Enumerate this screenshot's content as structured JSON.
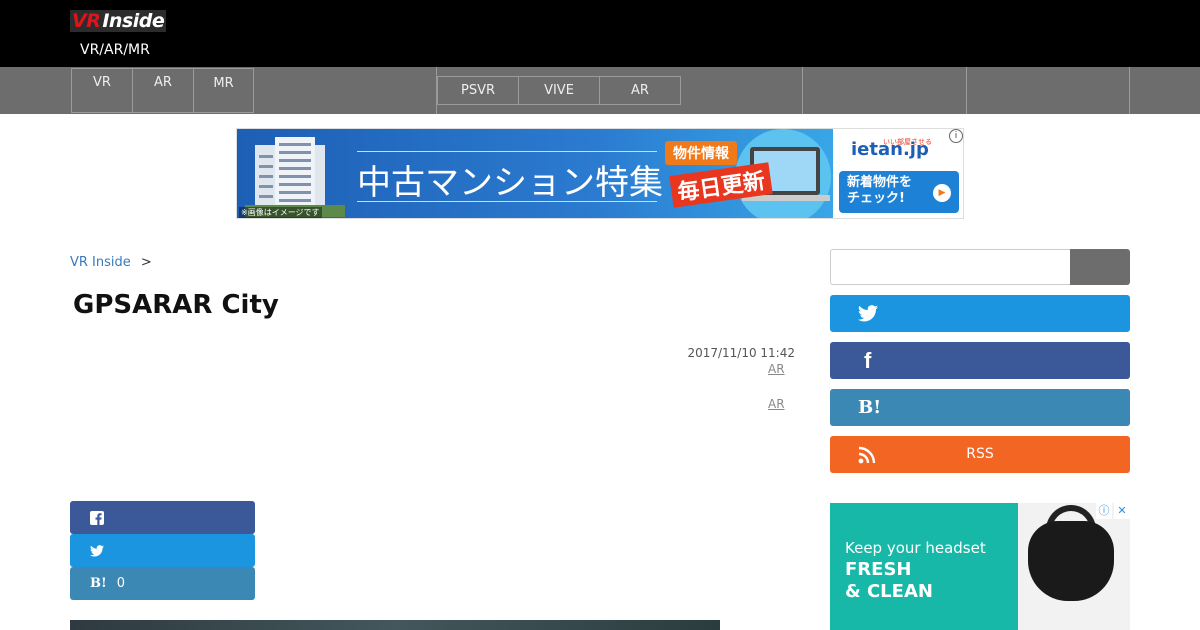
{
  "header": {
    "logo_vr": "VR",
    "logo_inside": "Inside",
    "tagline": "VR/AR/MR"
  },
  "nav": {
    "items": [
      "VR",
      "AR",
      "MR"
    ],
    "sub_tabs": [
      "PSVR",
      "VIVE",
      "AR"
    ]
  },
  "banner_ad": {
    "title": "中古マンション特集",
    "badge": "物件情報",
    "highlight": "毎日更新",
    "image_note": "※画像はイメージです",
    "brand_sub": "いい部屋させる",
    "brand": "ietan.jp",
    "cta_line1": "新着物件を",
    "cta_line2": "チェック!",
    "info": "i"
  },
  "breadcrumb": {
    "home": "VR Inside",
    "separator": ">"
  },
  "article": {
    "title": "GPSARAR City",
    "date": "2017/11/10 11:42",
    "tags": [
      "AR",
      "AR"
    ],
    "share": {
      "facebook_icon": "f",
      "twitter_icon": "twitter-bird",
      "hatena_icon": "B!",
      "hatena_count": "0"
    }
  },
  "sidebar": {
    "twitter_icon": "twitter-bird",
    "facebook_icon": "f",
    "hatena_icon": "B!",
    "rss_label": "RSS"
  },
  "side_ad": {
    "line1": "Keep your headset",
    "line2": "FRESH",
    "line3": "& CLEAN"
  },
  "colors": {
    "twitter": "#1b95e0",
    "facebook": "#3b5998",
    "hatena": "#3c88b5",
    "rss": "#f26522",
    "nav": "#6d6d6d"
  }
}
